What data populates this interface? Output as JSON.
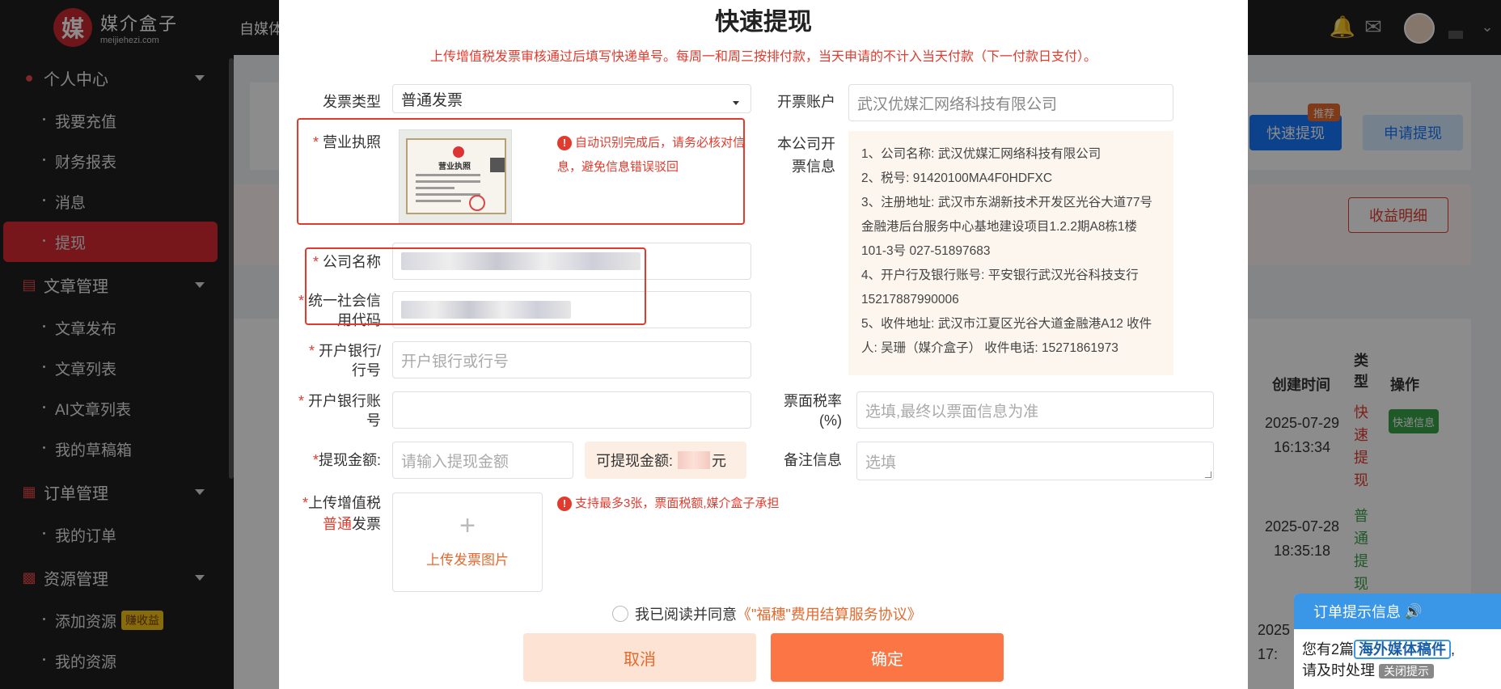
{
  "sidebar": {
    "logo_name": "媒介盒子",
    "logo_domain": "meijiehezi.com",
    "logo_mark": "媒",
    "groups": [
      {
        "label": "个人中心",
        "items": [
          "我要充值",
          "财务报表",
          "消息",
          "提现"
        ]
      },
      {
        "label": "文章管理",
        "items": [
          "文章发布",
          "文章列表",
          "AI文章列表",
          "我的草稿箱"
        ]
      },
      {
        "label": "订单管理",
        "items": [
          "我的订单"
        ]
      },
      {
        "label": "资源管理",
        "items": [
          "添加资源",
          "我的资源"
        ]
      }
    ],
    "earn_badge": "赚收益"
  },
  "topbar": {
    "crumb": "自媒体"
  },
  "background": {
    "btn_fast": "快速提现",
    "btn_fast_tag": "推荐",
    "btn_apply": "申请提现",
    "btn_income": "收益明细",
    "col_created": "创建时间",
    "col_type": "类型",
    "col_op": "操作",
    "rows": [
      {
        "date": "2025-07-29",
        "time": "16:13:34",
        "type": "快速提现",
        "op": "快递信息"
      },
      {
        "date": "2025-07-28",
        "time": "18:35:18",
        "type": "普通提现",
        "op": ""
      },
      {
        "date": "2025",
        "time": "17:",
        "type": "",
        "op": ""
      }
    ]
  },
  "modal": {
    "title": "快速提现",
    "notice": "上传增值税发票审核通过后填写快递单号。每周一和周三按排付款，当天申请的不计入当天付款（下一付款日支付）。",
    "invoice_type_label": "发票类型",
    "invoice_type_value": "普通发票",
    "billing_account_label": "开票账户",
    "billing_account_value": "武汉优媒汇网络科技有限公司",
    "license_label": "营业执照",
    "license_title": "营业执照",
    "license_warn": "自动识别完成后，请务必核对信息，避免信息错误驳回",
    "company_info_label": "本公司开票信息",
    "company_info": [
      "1、公司名称: 武汉优媒汇网络科技有限公司",
      "2、税号: 91420100MA4F0HDFXC",
      "3、注册地址: 武汉市东湖新技术开发区光谷大道77号金融港后台服务中心基地建设项目1.2.2期A8栋1楼101-3号 027-51897683",
      "4、开户行及银行账号: 平安银行武汉光谷科技支行15217887990006",
      "5、收件地址: 武汉市江夏区光谷大道金融港A12 收件人: 吴珊（媒介盒子） 收件电话: 15271861973"
    ],
    "company_name_label": "公司名称",
    "credit_code_label": "统一社会信用代码",
    "bank_label": "开户银行/行号",
    "bank_placeholder": "开户银行或行号",
    "account_label": "开户银行账号",
    "tax_rate_label": "票面税率(%)",
    "tax_rate_placeholder": "选填,最终以票面信息为准",
    "amount_label": "提现金额:",
    "amount_placeholder": "请输入提现金额",
    "available_label": "可提现金额:",
    "available_unit": "元",
    "remark_label": "备注信息",
    "remark_placeholder": "选填",
    "upload_label_a": "上传增值税",
    "upload_label_b_red": "普通",
    "upload_label_b": "发票",
    "upload_text": "上传发票图片",
    "upload_warn": "支持最多3张，票面税额,媒介盒子承担",
    "agree_text": "我已阅读并同意",
    "agree_link": "《\"福穗\"费用结算服务协议》",
    "cancel": "取消",
    "confirm": "确定"
  },
  "order_panel": {
    "title": "订单提示信息",
    "text_a": "您有2篇",
    "highlight": "海外媒体稿件",
    "text_b": "请及时处理",
    "close": "关闭提示"
  }
}
